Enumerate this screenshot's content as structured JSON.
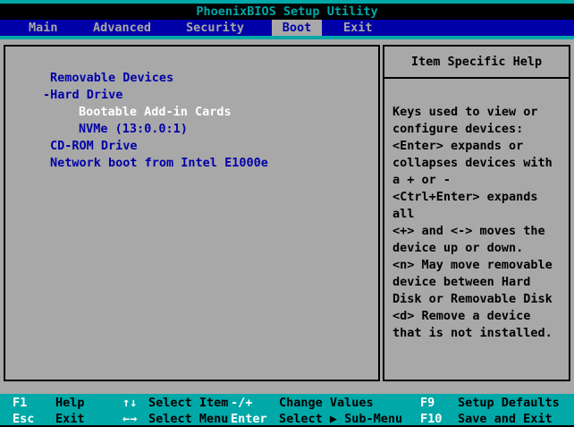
{
  "title": "PhoenixBIOS Setup Utility",
  "menu": {
    "selected": "Boot",
    "tabs": [
      {
        "label": "Main"
      },
      {
        "label": "Advanced"
      },
      {
        "label": "Security"
      },
      {
        "label": "Boot"
      },
      {
        "label": "Exit"
      }
    ]
  },
  "boot": {
    "items": [
      {
        "label": "Removable Devices",
        "selected": false
      },
      {
        "label": "-Hard Drive",
        "selected": false
      },
      {
        "label": "Bootable Add-in Cards",
        "selected": true
      },
      {
        "label": "NVMe (13:0.0:1)",
        "selected": false
      },
      {
        "label": "CD-ROM Drive",
        "selected": false
      },
      {
        "label": "Network boot from Intel E1000e",
        "selected": false
      }
    ]
  },
  "help": {
    "title": "Item Specific Help",
    "text": "Keys used to view or\nconfigure devices:\n<Enter> expands or\ncollapses devices with\na + or -\n<Ctrl+Enter> expands\nall\n<+> and <-> moves the\ndevice up or down.\n<n> May move removable\ndevice between Hard\nDisk or Removable Disk\n<d> Remove a device\nthat is not installed."
  },
  "footer": {
    "rows": [
      [
        {
          "key": "F1",
          "label": "Help"
        },
        {
          "key": "↑↓",
          "label": "Select Item"
        },
        {
          "key": "-/+",
          "label": "Change Values"
        },
        {
          "key": "F9",
          "label": "Setup Defaults"
        }
      ],
      [
        {
          "key": "Esc",
          "label": "Exit"
        },
        {
          "key": "←→",
          "label": "Select Menu"
        },
        {
          "key": "Enter",
          "label": "Select ▶ Sub-Menu"
        },
        {
          "key": "F10",
          "label": "Save and Exit"
        }
      ]
    ]
  },
  "colors": {
    "teal": "#00a8a8",
    "blue": "#0000a8",
    "gray": "#a8a8a8",
    "item_text": "#0000a8",
    "selected_item_text": "#ffffff"
  }
}
